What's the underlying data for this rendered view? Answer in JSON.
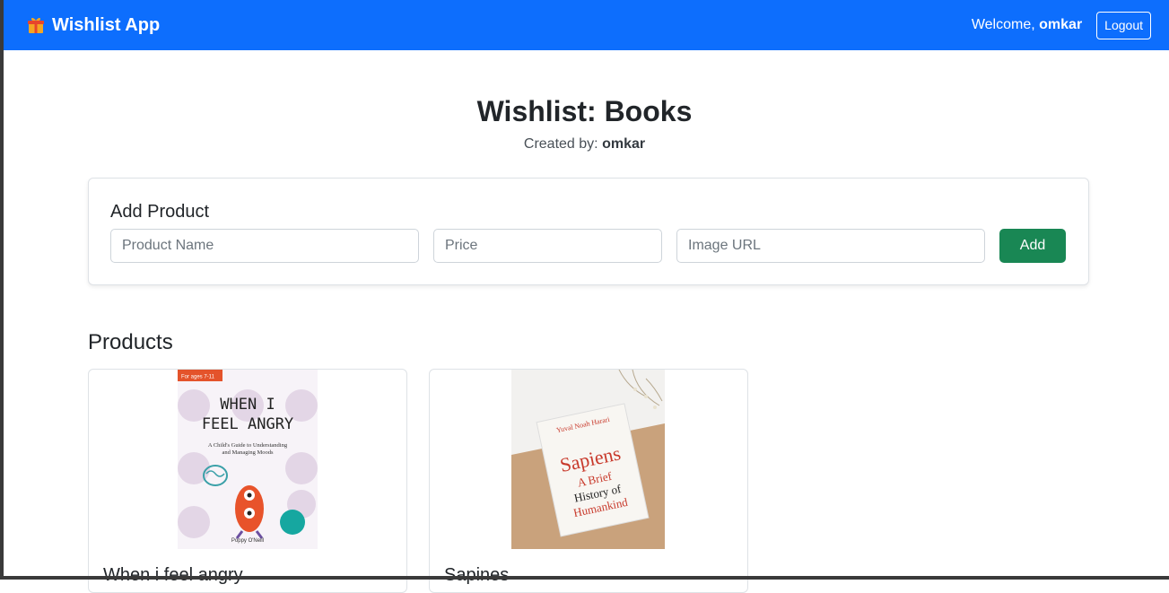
{
  "navbar": {
    "brand": "Wishlist App",
    "brand_icon": "gift-icon",
    "welcome_prefix": "Welcome,",
    "username": "omkar",
    "logout_label": "Logout",
    "color": "#0d6efd"
  },
  "page": {
    "title": "Wishlist: Books",
    "created_by_label": "Created by:",
    "created_by_user": "omkar"
  },
  "add_product": {
    "title": "Add Product",
    "name_placeholder": "Product Name",
    "price_placeholder": "Price",
    "image_url_placeholder": "Image URL",
    "add_label": "Add",
    "add_color": "#198754"
  },
  "products": {
    "heading": "Products",
    "items": [
      {
        "name": "When i feel angry",
        "cover": {
          "badge": "For ages 7-11",
          "title_line1": "WHEN I",
          "title_line2": "FEEL ANGRY",
          "subtitle_line1": "A Child's Guide to Understanding",
          "subtitle_line2": "and Managing Moods",
          "author": "Poppy O'Neill"
        }
      },
      {
        "name": "Sapines",
        "cover": {
          "author": "Yuval Noah Harari",
          "title": "Sapiens",
          "subtitle_line1": "A Brief",
          "subtitle_line2": "History of",
          "subtitle_line3": "Humankind"
        }
      }
    ]
  }
}
